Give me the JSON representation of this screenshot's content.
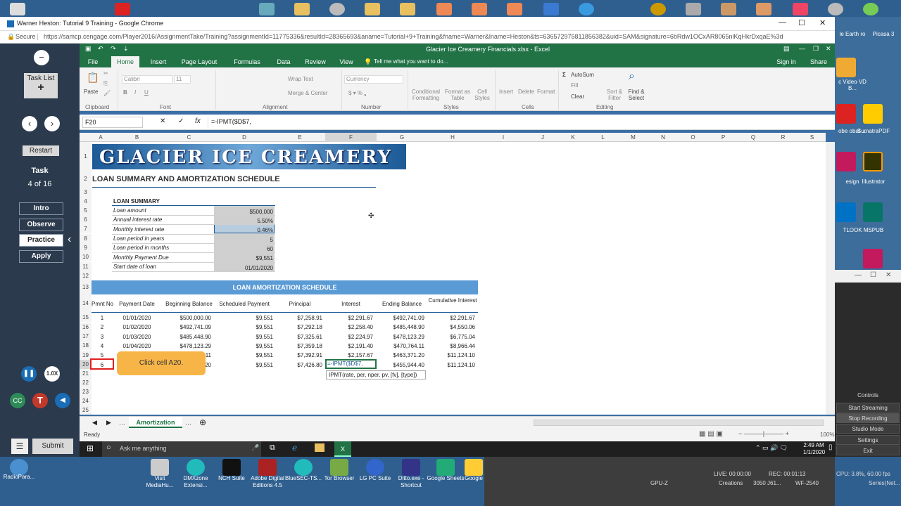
{
  "chrome": {
    "window_title": "Warner Heston: Tutorial 9 Training - Google Chrome",
    "secure": "Secure",
    "url": "https://samcp.cengage.com/Player2016/AssignmentTake/Training?assignmentId=11775336&resultId=28365693&aname=Tutorial+9+Training&fname=Warner&lname=Heston&ts=636572975811856382&uid=SAM&signature=6bRdw1OCxAR8065nlKqHkrDxqaE%3d"
  },
  "sam": {
    "task_list": "Task List",
    "restart": "Restart",
    "task_label": "Task",
    "task_progress": "4 of 16",
    "modes": [
      "Intro",
      "Observe",
      "Practice",
      "Apply"
    ],
    "active_mode": "Practice",
    "speed": "1.0X",
    "cc": "CC",
    "t": "T",
    "submit": "Submit",
    "tooltip": "Click cell A20."
  },
  "excel": {
    "title": "Glacier Ice Creamery Financials.xlsx - Excel",
    "tabs": [
      "File",
      "Home",
      "Insert",
      "Page Layout",
      "Formulas",
      "Data",
      "Review",
      "View"
    ],
    "active_tab": "Home",
    "tell_me": "Tell me what you want to do...",
    "sign_in": "Sign in",
    "share": "Share",
    "ribbon": {
      "paste": "Paste",
      "font_name": "Calibri",
      "font_size": "11",
      "wrap_text": "Wrap Text",
      "merge": "Merge & Center",
      "number_format": "Currency",
      "conditional": "Conditional Formatting",
      "format_table": "Format as Table",
      "cell_styles": "Cell Styles",
      "insert": "Insert",
      "delete": "Delete",
      "format": "Format",
      "autosum": "AutoSum",
      "fill": "Fill",
      "clear": "Clear",
      "sort": "Sort & Filter",
      "find": "Find & Select",
      "groups": [
        "Clipboard",
        "Font",
        "Alignment",
        "Number",
        "Styles",
        "Cells",
        "Editing"
      ]
    },
    "name_box": "F20",
    "formula": "=-IPMT($D$7,",
    "columns": [
      "A",
      "B",
      "C",
      "D",
      "E",
      "F",
      "G",
      "H",
      "I",
      "J",
      "K",
      "L",
      "M",
      "N",
      "O",
      "P",
      "Q",
      "R",
      "S"
    ],
    "banner": "GLACIER ICE CREAMERY",
    "heading": "LOAN SUMMARY AND AMORTIZATION SCHEDULE",
    "loan_summary_title": "LOAN SUMMARY",
    "loan_summary": [
      {
        "label": "Loan amount",
        "value": "$500,000"
      },
      {
        "label": "Annual interest rate",
        "value": "5.50%"
      },
      {
        "label": "Monthly interest rate",
        "value": "0.46%"
      },
      {
        "label": "Loan period in years",
        "value": "5"
      },
      {
        "label": "Loan period in months",
        "value": "60"
      },
      {
        "label": "Monthly Payment Due",
        "value": "$9,551"
      },
      {
        "label": "Start date of loan",
        "value": "01/01/2020"
      }
    ],
    "amort_title": "LOAN AMORTIZATION SCHEDULE",
    "amort_headers": [
      "Pmnt No",
      "Payment Date",
      "Beginning Balance",
      "Scheduled Payment",
      "Principal",
      "Interest",
      "Ending Balance",
      "Cumulative Interest"
    ],
    "amort_rows": [
      [
        "1",
        "01/01/2020",
        "$500,000.00",
        "$9,551",
        "$7,258.91",
        "$2,291.67",
        "$492,741.09",
        "$2,291.67"
      ],
      [
        "2",
        "01/02/2020",
        "$492,741.09",
        "$9,551",
        "$7,292.18",
        "$2,258.40",
        "$485,448.90",
        "$4,550.06"
      ],
      [
        "3",
        "01/03/2020",
        "$485,448.90",
        "$9,551",
        "$7,325.61",
        "$2,224.97",
        "$478,123.29",
        "$6,775.04"
      ],
      [
        "4",
        "01/04/2020",
        "$478,123.29",
        "$9,551",
        "$7,359.18",
        "$2,191.40",
        "$470,764.11",
        "$8,966.44"
      ],
      [
        "5",
        "",
        "11",
        "$9,551",
        "$7,392.91",
        "$2,157.67",
        "$463,371.20",
        "$11,124.10"
      ],
      [
        "6",
        "",
        "20",
        "$9,551",
        "$7,426.80",
        "=-IPMT($D$7,",
        "$455,944.40",
        "$11,124.10"
      ]
    ],
    "func_tip": "IPMT(rate, per, nper, pv, [fv], [type])",
    "sheet_tab": "Amortization",
    "status": "Ready",
    "zoom": "100%"
  },
  "taskbar": {
    "search": "Ask me anything",
    "time": "2:49 AM",
    "date": "1/1/2020"
  },
  "desktop_bottom": [
    "RadioPara...",
    "Visit MediaHu...",
    "DMXzone Extensi...",
    "NCH Suite",
    "Adobe Digital Editions 4.5",
    "BlueSEC-TS...",
    "Tor Browser",
    "LG PC Suite",
    "Ditto.exe - Shortcut",
    "Google Sheets",
    "Google"
  ],
  "desktop_right": [
    "le Earth ro",
    "Picasa 3",
    "c Video VD B...",
    "obe obat ...",
    "SumatraPDF",
    "esign",
    "Illustrator",
    "TLOOK",
    "MSPUB"
  ],
  "recorder": {
    "buttons": [
      "Controls",
      "Start Streaming",
      "Stop Recording",
      "Studio Mode",
      "Settings",
      "Exit"
    ],
    "live": "LIVE: 00:00:00",
    "rec": "REC: 00:01:13",
    "cpu": "CPU: 3.8%, 60.00 fps",
    "gpu": "GPU-Z",
    "creations": "Creations",
    "model": "3050 J61...",
    "wf": "WF-2540",
    "series": "Series(Net..."
  }
}
